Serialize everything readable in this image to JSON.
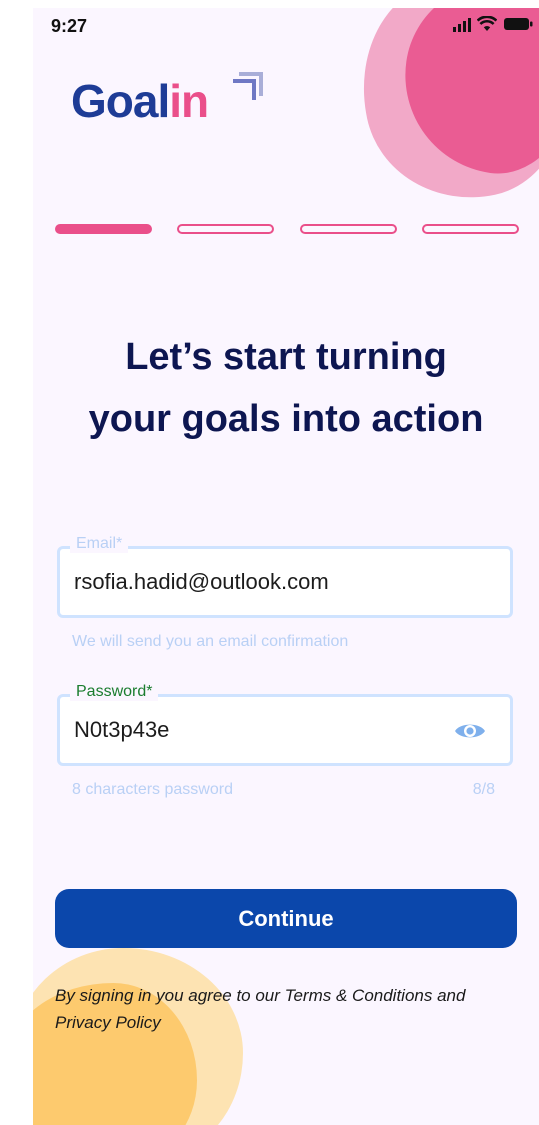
{
  "status_bar": {
    "time": "9:27",
    "icons": [
      "signal-icon",
      "wifi-icon",
      "battery-icon"
    ]
  },
  "brand": {
    "logo_part1": "Goal",
    "logo_part2": "in",
    "icon": "arrow-up-right-icon"
  },
  "progress": {
    "total_steps": 4,
    "current_step": 1
  },
  "headline": {
    "line1": "Let’s start turning",
    "line2": "your goals into action"
  },
  "email": {
    "label": "Email*",
    "value": "rsofia.hadid@outlook.com",
    "helper": "We will send you an email confirmation"
  },
  "password": {
    "label": "Password*",
    "value": "N0t3p43e",
    "helper": "8 characters password",
    "counter": "8/8",
    "icon": "eye-icon"
  },
  "continue_label": "Continue",
  "terms": {
    "prefix": "By signing in you agree to our ",
    "terms_link": "Terms & Conditions",
    "conjunction": " and ",
    "privacy_link": "Privacy Policy"
  },
  "colors": {
    "brand_blue": "#1e3c96",
    "accent_pink": "#ea4f8a",
    "button_blue": "#0b47ab",
    "headline_navy": "#0d1651",
    "email_label": "#b9d0f5",
    "password_label": "#1b7d2f",
    "field_border": "#cfe3ff"
  }
}
